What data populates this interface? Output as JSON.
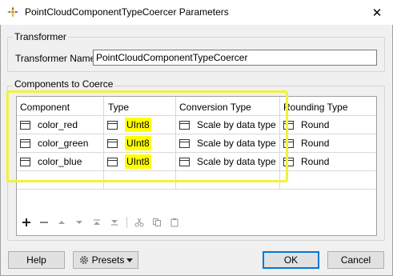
{
  "window": {
    "title": "PointCloudComponentTypeCoercer Parameters",
    "close_glyph": "✕"
  },
  "transformer": {
    "group_label": "Transformer",
    "name_label": "Transformer Name:",
    "name_value": "PointCloudComponentTypeCoercer"
  },
  "components": {
    "group_label": "Components to Coerce",
    "columns": [
      "Component",
      "Type",
      "Conversion Type",
      "Rounding Type"
    ],
    "rows": [
      {
        "component": "color_red",
        "type": "UInt8",
        "conversion": "Scale by data type",
        "rounding": "Round"
      },
      {
        "component": "color_green",
        "type": "UInt8",
        "conversion": "Scale by data type",
        "rounding": "Round"
      },
      {
        "component": "color_blue",
        "type": "UInt8",
        "conversion": "Scale by data type",
        "rounding": "Round"
      }
    ],
    "highlight_color": "#ffff00",
    "annotation_color": "#f2f23a"
  },
  "toolbar": {
    "icons": [
      "add-icon",
      "remove-icon",
      "move-up-icon",
      "move-down-icon",
      "move-top-icon",
      "move-bottom-icon",
      "cut-icon",
      "copy-icon",
      "paste-icon"
    ]
  },
  "buttons": {
    "help": "Help",
    "presets": "Presets",
    "ok": "OK",
    "cancel": "Cancel"
  }
}
